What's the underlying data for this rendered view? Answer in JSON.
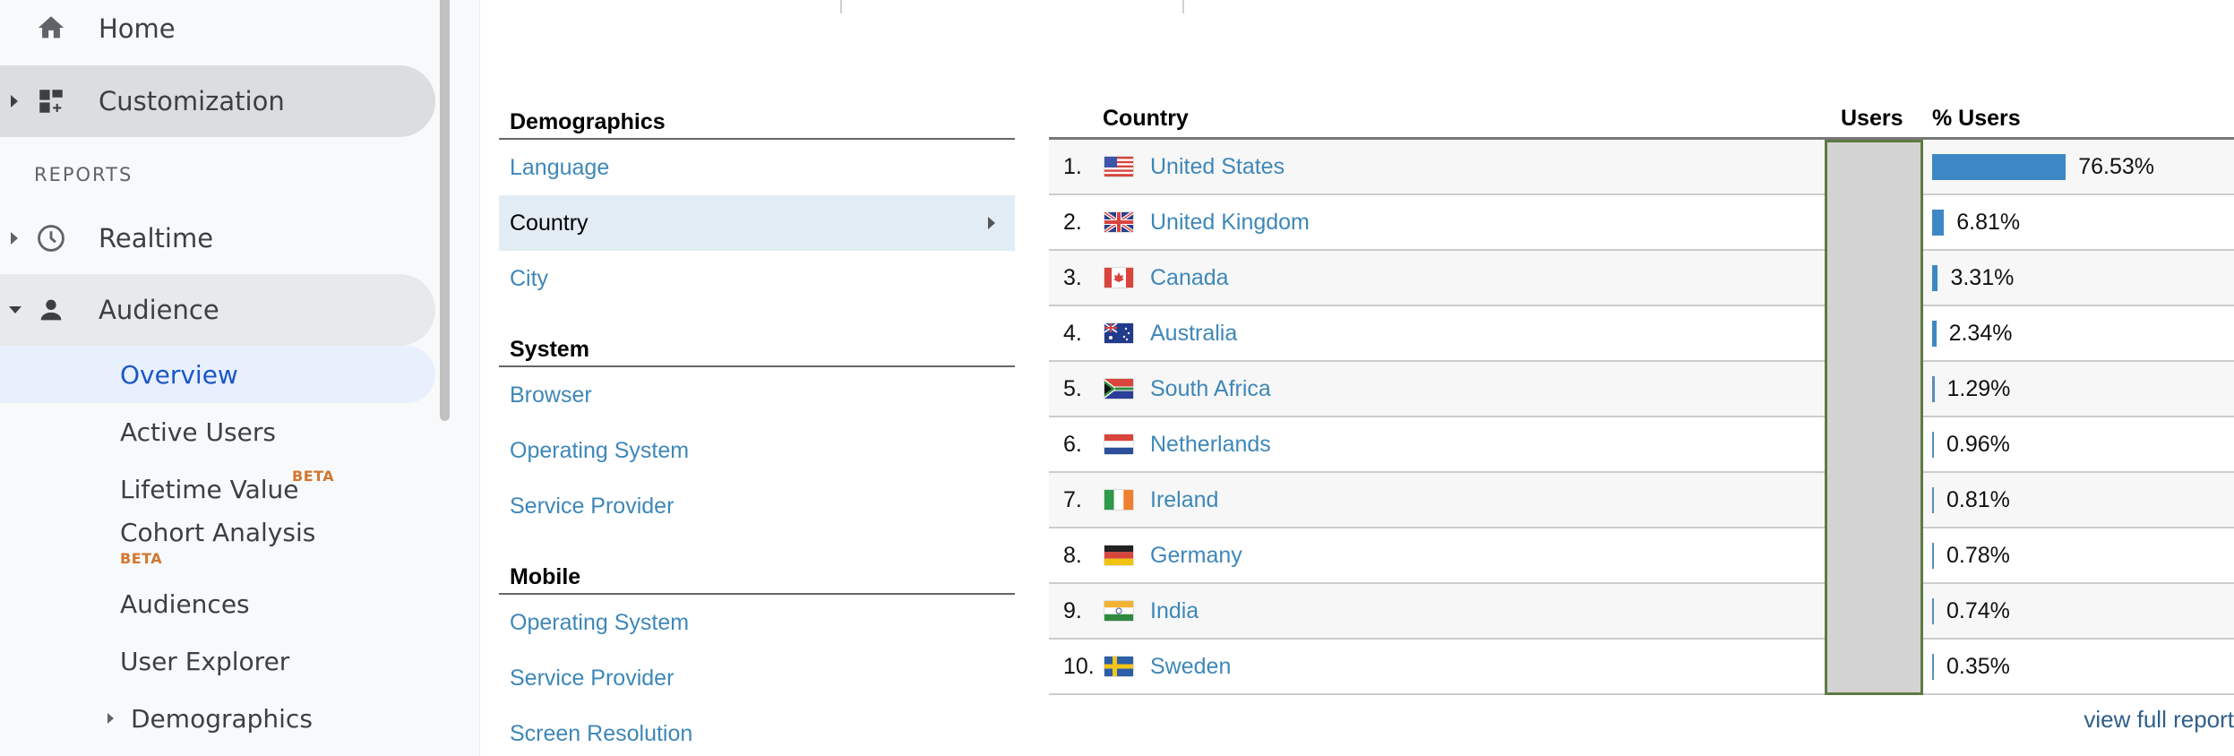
{
  "sidebar": {
    "items": [
      {
        "label": "Home",
        "icon": "home-icon"
      },
      {
        "label": "Customization",
        "icon": "dashboard-add-icon"
      }
    ],
    "section_label": "REPORTS",
    "reports": [
      {
        "label": "Realtime",
        "icon": "clock-icon"
      },
      {
        "label": "Audience",
        "icon": "person-icon"
      }
    ],
    "audience_sub": [
      {
        "label": "Overview"
      },
      {
        "label": "Active Users"
      },
      {
        "label": "Lifetime Value",
        "badge": "BETA"
      },
      {
        "label": "Cohort Analysis",
        "badge": "BETA"
      },
      {
        "label": "Audiences"
      },
      {
        "label": "User Explorer"
      },
      {
        "label": "Demographics"
      }
    ]
  },
  "dimensions": {
    "groups": [
      {
        "heading": "Demographics",
        "links": [
          "Language",
          "Country",
          "City"
        ]
      },
      {
        "heading": "System",
        "links": [
          "Browser",
          "Operating System",
          "Service Provider"
        ]
      },
      {
        "heading": "Mobile",
        "links": [
          "Operating System",
          "Service Provider",
          "Screen Resolution"
        ]
      }
    ],
    "selected": "Country"
  },
  "table": {
    "headers": {
      "country": "Country",
      "users": "Users",
      "pct_users": "% Users"
    },
    "rows": [
      {
        "rank": "1.",
        "country": "United States",
        "flag": "us",
        "pct": 76.53,
        "pct_label": "76.53%"
      },
      {
        "rank": "2.",
        "country": "United Kingdom",
        "flag": "gb",
        "pct": 6.81,
        "pct_label": "6.81%"
      },
      {
        "rank": "3.",
        "country": "Canada",
        "flag": "ca",
        "pct": 3.31,
        "pct_label": "3.31%"
      },
      {
        "rank": "4.",
        "country": "Australia",
        "flag": "au",
        "pct": 2.34,
        "pct_label": "2.34%"
      },
      {
        "rank": "5.",
        "country": "South Africa",
        "flag": "za",
        "pct": 1.29,
        "pct_label": "1.29%"
      },
      {
        "rank": "6.",
        "country": "Netherlands",
        "flag": "nl",
        "pct": 0.96,
        "pct_label": "0.96%"
      },
      {
        "rank": "7.",
        "country": "Ireland",
        "flag": "ie",
        "pct": 0.81,
        "pct_label": "0.81%"
      },
      {
        "rank": "8.",
        "country": "Germany",
        "flag": "de",
        "pct": 0.78,
        "pct_label": "0.78%"
      },
      {
        "rank": "9.",
        "country": "India",
        "flag": "in",
        "pct": 0.74,
        "pct_label": "0.74%"
      },
      {
        "rank": "10.",
        "country": "Sweden",
        "flag": "se",
        "pct": 0.35,
        "pct_label": "0.35%"
      }
    ],
    "view_full_report": "view full report"
  },
  "colors": {
    "bar": "#3d88c4",
    "link": "#3e87b8",
    "selected_row": "#e1ecf4",
    "users_redacted_fill": "#d3d3d3",
    "users_redacted_border": "#5e7a44",
    "beta_badge": "#d2762f",
    "active_nav": "#1a56c8"
  }
}
